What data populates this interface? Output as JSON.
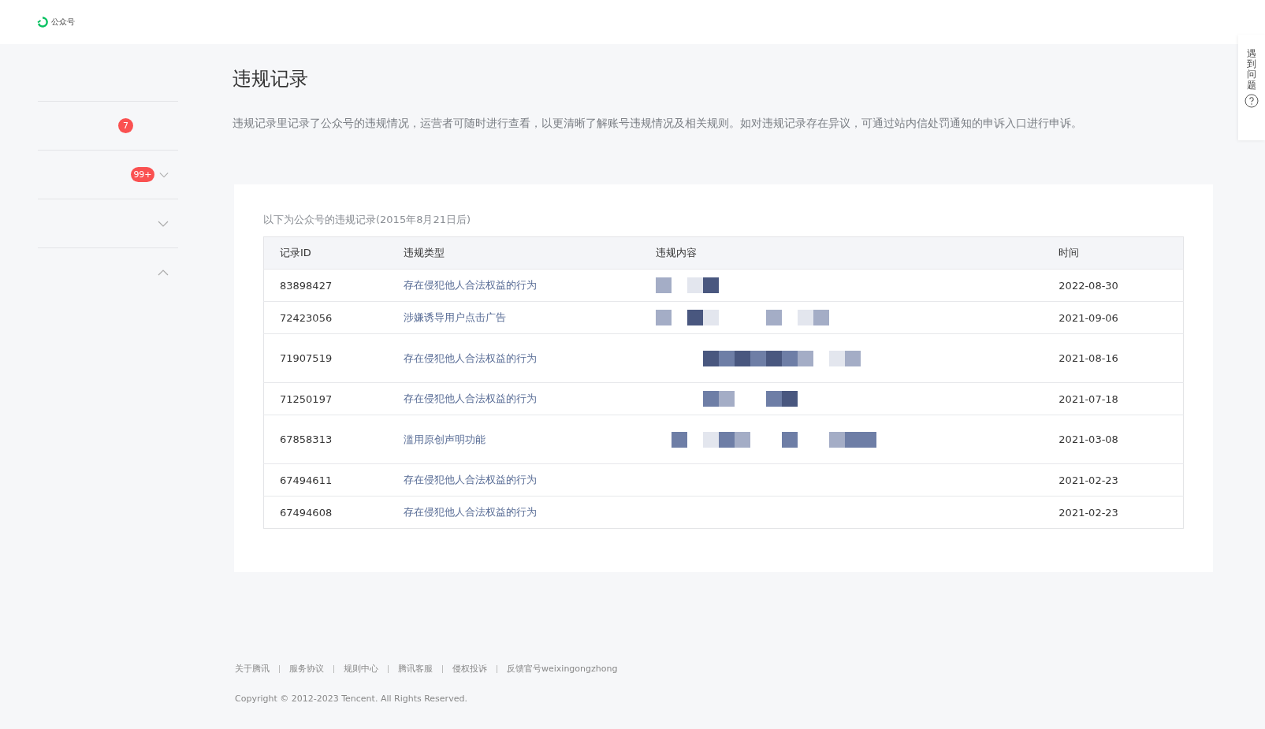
{
  "header": {
    "logo_text": "公众号"
  },
  "sidebar": {
    "items": [
      {
        "badge": "7"
      },
      {
        "badge": "99+",
        "expanded": false
      },
      {
        "expanded": false
      },
      {
        "expanded": true
      }
    ]
  },
  "page": {
    "title": "违规记录",
    "description": "违规记录里记录了公众号的违规情况，运营者可随时进行查看，以更清晰了解账号违规情况及相关规则。如对违规记录存在异议，可通过站内信处罚通知的申诉入口进行申诉。"
  },
  "records": {
    "caption": "以下为公众号的违规记录(2015年8月21日后)",
    "table": {
      "columns": [
        "记录ID",
        "违规类型",
        "违规内容",
        "时间"
      ],
      "rows": [
        {
          "id": "83898427",
          "type": "存在侵犯他人合法权益的行为",
          "time": "2022-08-30"
        },
        {
          "id": "72423056",
          "type": "涉嫌诱导用户点击广告",
          "time": "2021-09-06"
        },
        {
          "id": "71907519",
          "type": "存在侵犯他人合法权益的行为",
          "time": "2021-08-16"
        },
        {
          "id": "71250197",
          "type": "存在侵犯他人合法权益的行为",
          "time": "2021-07-18"
        },
        {
          "id": "67858313",
          "type": "滥用原创声明功能",
          "time": "2021-03-08"
        },
        {
          "id": "67494611",
          "type": "存在侵犯他人合法权益的行为",
          "time": "2021-02-23"
        },
        {
          "id": "67494608",
          "type": "存在侵犯他人合法权益的行为",
          "time": "2021-02-23"
        }
      ]
    }
  },
  "help_tab": {
    "label": "遇到问题"
  },
  "footer": {
    "links": [
      "关于腾讯",
      "服务协议",
      "规则中心",
      "腾讯客服",
      "侵权投诉",
      "反馈官号weixingongzhong"
    ],
    "copyright": "Copyright © 2012-2023 Tencent. All Rights Reserved."
  }
}
